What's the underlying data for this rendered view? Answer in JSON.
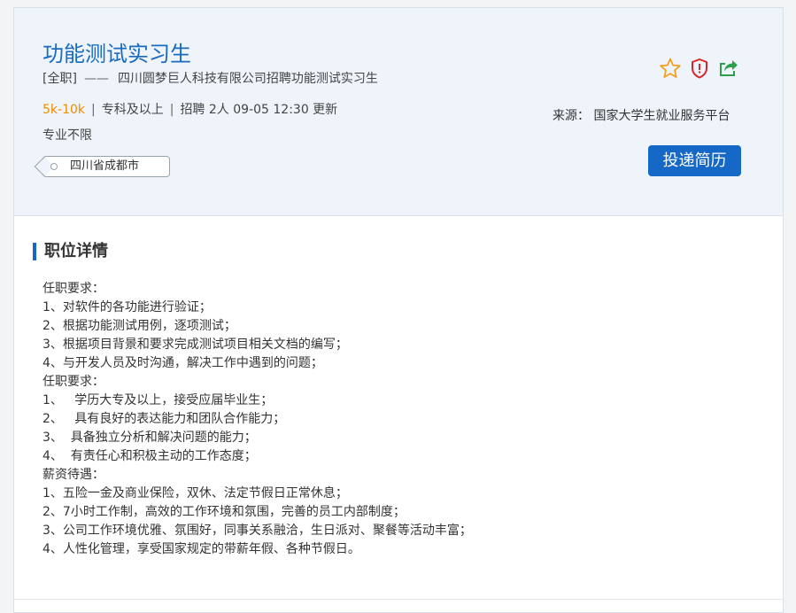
{
  "job": {
    "title": "功能测试实习生",
    "type": "[全职]",
    "dash": "——",
    "company_line": "四川圆梦巨人科技有限公司招聘功能测试实习生",
    "salary": "5k-10k",
    "separator": "|",
    "education": "专科及以上",
    "headcount": "招聘 2人",
    "updated": "09-05 12:30 更新",
    "major": "专业不限",
    "location": "四川省成都市"
  },
  "actions": {
    "icons": [
      "star-icon",
      "shield-alert-icon",
      "share-icon"
    ],
    "source": "来源： 国家大学生就业服务平台",
    "apply_label": "投递简历"
  },
  "colors": {
    "accent": "#1668c7",
    "title": "#1a6bc0",
    "salary": "#f08c00",
    "star": "#f0a020",
    "shield": "#d9262b",
    "share": "#2e9e4a",
    "header_bg": "#eef4f9"
  },
  "details": {
    "section_title": "职位详情",
    "lines": [
      "任职要求：",
      "1、对软件的各功能进行验证；",
      "2、根据功能测试用例，逐项测试；",
      "3、根据项目背景和要求完成测试项目相关文档的编写；",
      "4、与开发人员及时沟通，解决工作中遇到的问题；",
      "任职要求：",
      "1、   学历大专及以上，接受应届毕业生；",
      "2、   具有良好的表达能力和团队合作能力；",
      "3、  具备独立分析和解决问题的能力；",
      "4、  有责任心和积极主动的工作态度；",
      "薪资待遇：",
      "1、五险一金及商业保险，双休、法定节假日正常休息；",
      "2、7小时工作制，高效的工作环境和氛围，完善的员工内部制度；",
      "3、公司工作环境优雅、氛围好，同事关系融洽，生日派对、聚餐等活动丰富；",
      "4、人性化管理，享受国家规定的带薪年假、各种节假日。"
    ]
  }
}
